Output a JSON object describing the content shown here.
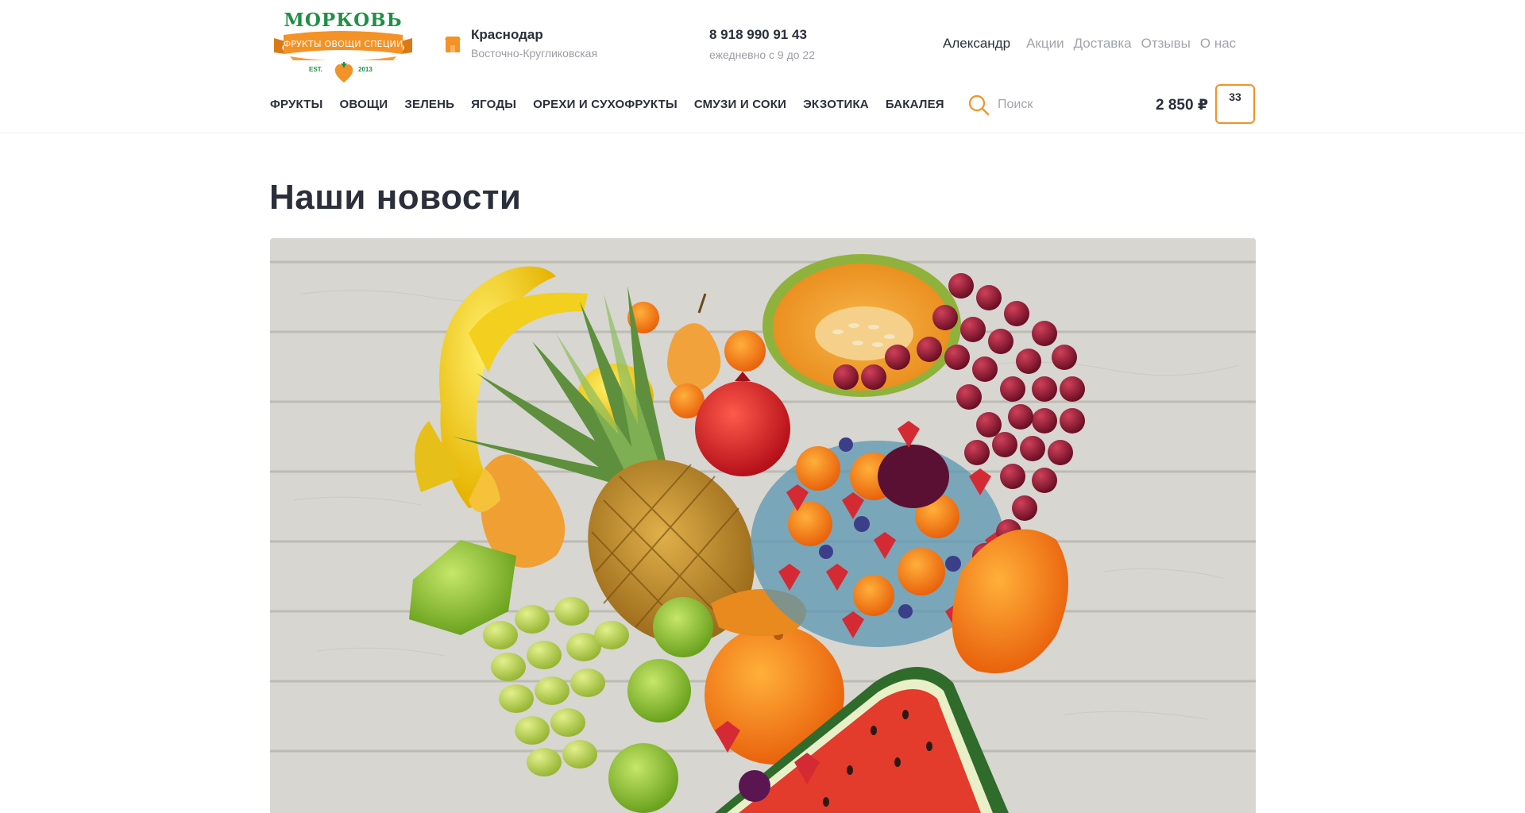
{
  "brand": {
    "name": "МОРКОВЬ",
    "tagline": "ФРУКТЫ ОВОЩИ СПЕЦИИ",
    "est_label": "EST.",
    "est_year": "2013",
    "colors": {
      "green": "#1f8f47",
      "orange": "#f39227"
    }
  },
  "location": {
    "icon": "store-icon",
    "city": "Краснодар",
    "street": "Восточно-Кругликовская"
  },
  "contact": {
    "phone": "8 918 990 91 43",
    "hours": "ежедневно с 9 до 22"
  },
  "top_nav": {
    "user_name": "Александр",
    "links": [
      "Акции",
      "Доставка",
      "Отзывы",
      "О нас"
    ]
  },
  "categories": [
    "ФРУКТЫ",
    "ОВОЩИ",
    "ЗЕЛЕНЬ",
    "ЯГОДЫ",
    "ОРЕХИ И СУХОФРУКТЫ",
    "СМУЗИ И СОКИ",
    "ЭКЗОТИКА",
    "БАКАЛЕЯ"
  ],
  "search": {
    "icon": "search-icon",
    "placeholder": "Поиск"
  },
  "cart": {
    "total": "2 850 ₽",
    "count": "33",
    "accent": "#f39227"
  },
  "main": {
    "title": "Наши новости"
  }
}
